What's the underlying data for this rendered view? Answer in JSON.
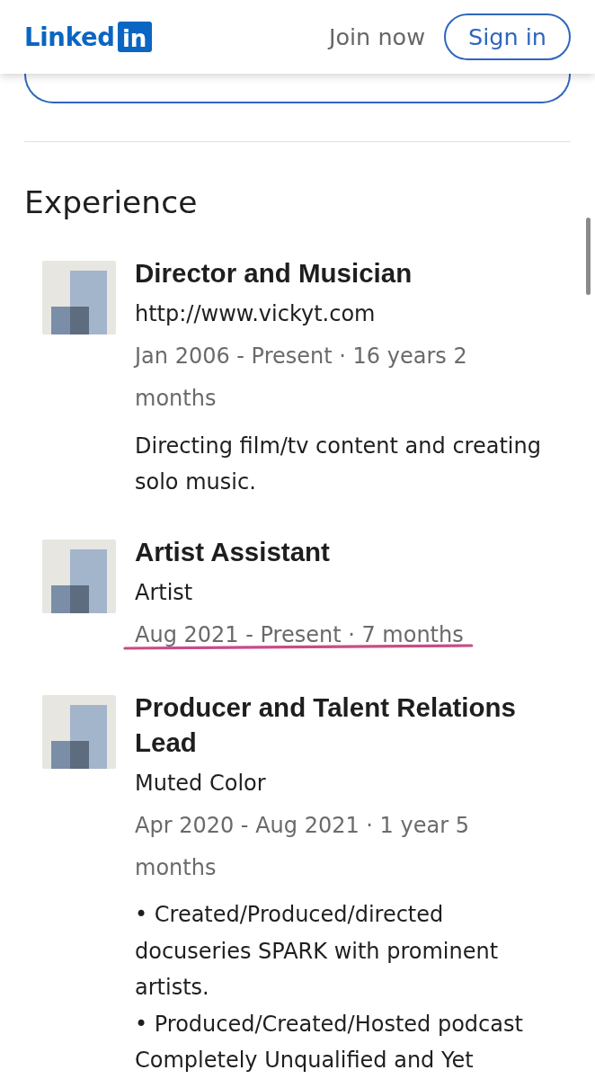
{
  "header": {
    "logo": {
      "text": "Linked",
      "badge": "in"
    },
    "join_link": "Join now",
    "sign_in_button": "Sign in"
  },
  "experience": {
    "heading": "Experience",
    "items": [
      {
        "title": "Director and Musician",
        "company": "http://www.vickyt.com",
        "dates": "Jan 2006 - Present · 16 years 2 months",
        "underlined": false,
        "description": [
          "Directing film/tv content and creating solo music."
        ]
      },
      {
        "title": "Artist Assistant",
        "company": "Artist",
        "dates": "Aug 2021 - Present · 7 months",
        "underlined": true
      },
      {
        "title": "Producer and Talent Relations Lead",
        "company": "Muted Color",
        "dates": "Apr 2020 - Aug 2021 · 1 year 5 months",
        "underlined": false,
        "description": [
          "• Created/Produced/directed docuseries SPARK with prominent artists.",
          "• Produced/Created/Hosted podcast Completely Unqualified and Yet"
        ]
      }
    ]
  }
}
